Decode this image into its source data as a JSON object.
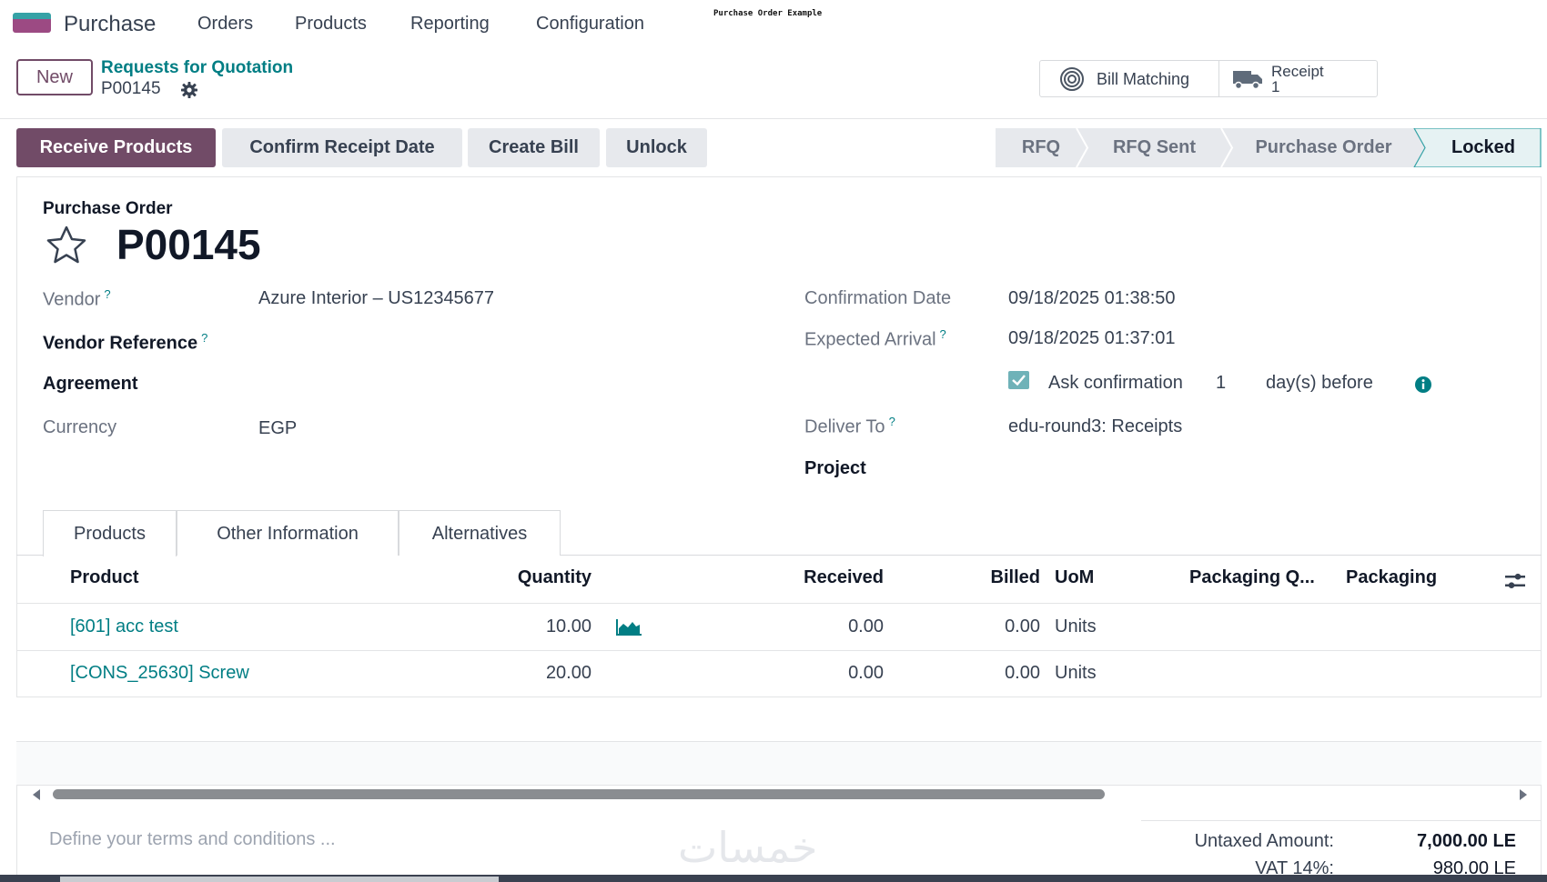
{
  "app": {
    "name": "Purchase"
  },
  "menu": [
    "Orders",
    "Products",
    "Reporting",
    "Configuration"
  ],
  "page_caption": "Purchase Order Example",
  "control_panel": {
    "new_label": "New",
    "breadcrumb": "Requests for Quotation",
    "record_name": "P00145",
    "smart_buttons": {
      "bill_matching": "Bill Matching",
      "receipt_label": "Receipt",
      "receipt_count": "1"
    }
  },
  "actions": {
    "receive_products": "Receive Products",
    "confirm_receipt_date": "Confirm Receipt Date",
    "create_bill": "Create Bill",
    "unlock": "Unlock"
  },
  "statusbar": {
    "stages": [
      "RFQ",
      "RFQ Sent",
      "Purchase Order",
      "Locked"
    ],
    "current": "Locked"
  },
  "form": {
    "subtitle": "Purchase Order",
    "title": "P00145",
    "left": {
      "vendor_label": "Vendor",
      "vendor_value": "Azure Interior – US12345677",
      "vendor_ref_label": "Vendor Reference",
      "agreement_label": "Agreement",
      "currency_label": "Currency",
      "currency_value": "EGP"
    },
    "right": {
      "confirmation_date_label": "Confirmation Date",
      "confirmation_date_value": "09/18/2025 01:38:50",
      "expected_arrival_label": "Expected Arrival",
      "expected_arrival_value": "09/18/2025 01:37:01",
      "ask_confirmation_label": "Ask confirmation",
      "ask_confirmation_days": "1",
      "days_before_label": "day(s) before",
      "deliver_to_label": "Deliver To",
      "deliver_to_value": "edu-round3: Receipts",
      "project_label": "Project"
    },
    "help_mark": "?"
  },
  "tabs": [
    "Products",
    "Other Information",
    "Alternatives"
  ],
  "table": {
    "headers": {
      "product": "Product",
      "quantity": "Quantity",
      "received": "Received",
      "billed": "Billed",
      "uom": "UoM",
      "packaging_qty": "Packaging Q...",
      "packaging": "Packaging"
    },
    "rows": [
      {
        "product": "[601] acc test",
        "quantity": "10.00",
        "received": "0.00",
        "billed": "0.00",
        "uom": "Units"
      },
      {
        "product": "[CONS_25630] Screw",
        "quantity": "20.00",
        "received": "0.00",
        "billed": "0.00",
        "uom": "Units"
      }
    ]
  },
  "footer": {
    "terms_placeholder": "Define your terms and conditions ...",
    "untaxed_label": "Untaxed Amount:",
    "untaxed_value": "7,000.00 LE",
    "vat_label": "VAT 14%:",
    "vat_value": "980.00 LE",
    "watermark": "خمسات"
  },
  "colors": {
    "primary": "#714b67",
    "link": "#017e84",
    "active_stage": "#e6f2f3"
  }
}
